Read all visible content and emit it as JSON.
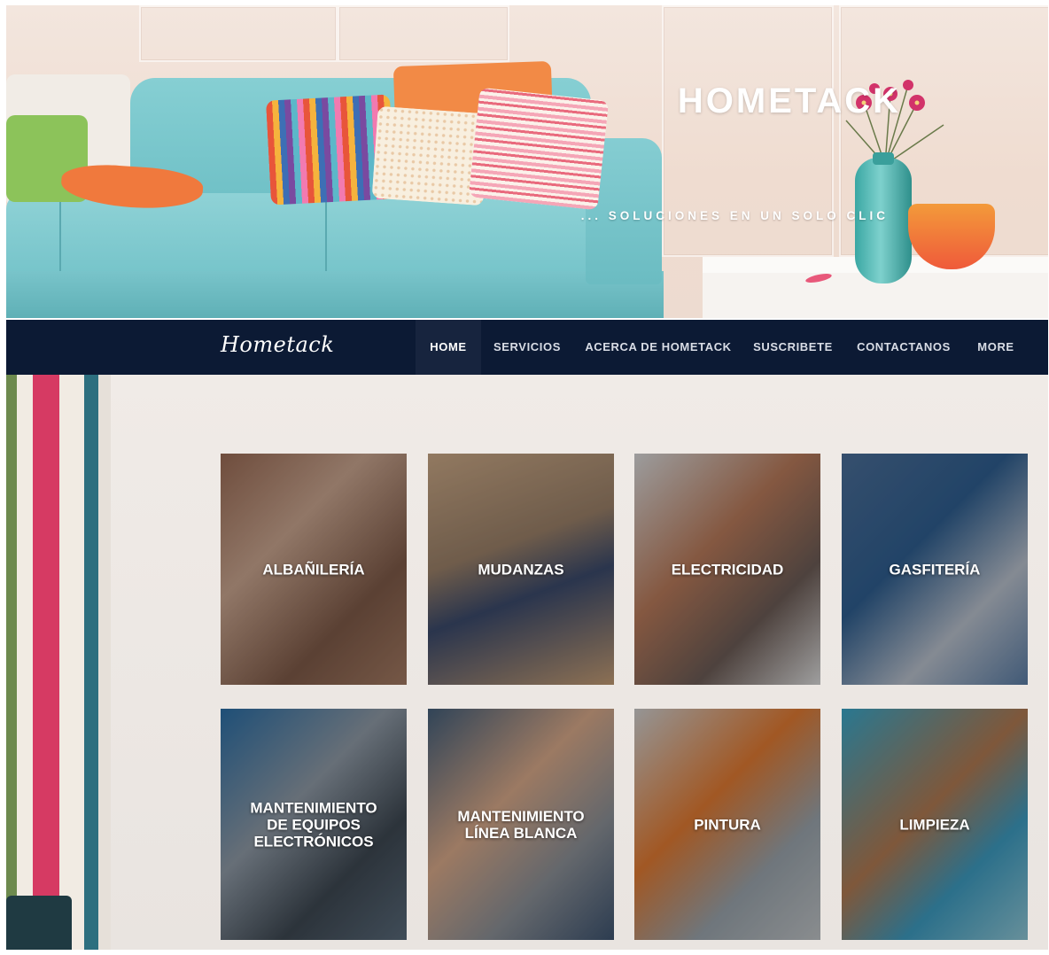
{
  "hero": {
    "title": "HOMETACK",
    "subtitle": "... SOLUCIONES EN UN SOLO CLIC"
  },
  "nav": {
    "brand": "Hometack",
    "items": [
      {
        "label": "HOME",
        "active": true
      },
      {
        "label": "SERVICIOS",
        "active": false
      },
      {
        "label": "ACERCA DE HOMETACK",
        "active": false
      },
      {
        "label": "SUSCRIBETE",
        "active": false
      },
      {
        "label": "CONTACTANOS",
        "active": false
      },
      {
        "label": "MORE",
        "active": false
      }
    ]
  },
  "services": [
    {
      "label": "ALBAÑILERÍA"
    },
    {
      "label": "MUDANZAS"
    },
    {
      "label": "ELECTRICIDAD"
    },
    {
      "label": "GASFITERÍA"
    },
    {
      "label": "MANTENIMIENTO\nDE EQUIPOS\nELECTRÓNICOS"
    },
    {
      "label": "MANTENIMIENTO\nLÍNEA BLANCA"
    },
    {
      "label": "PINTURA"
    },
    {
      "label": "LIMPIEZA"
    }
  ],
  "colors": {
    "nav_bg": "#0c1a34",
    "nav_active_bg": "#17243e",
    "sofa": "#74c3c9"
  }
}
